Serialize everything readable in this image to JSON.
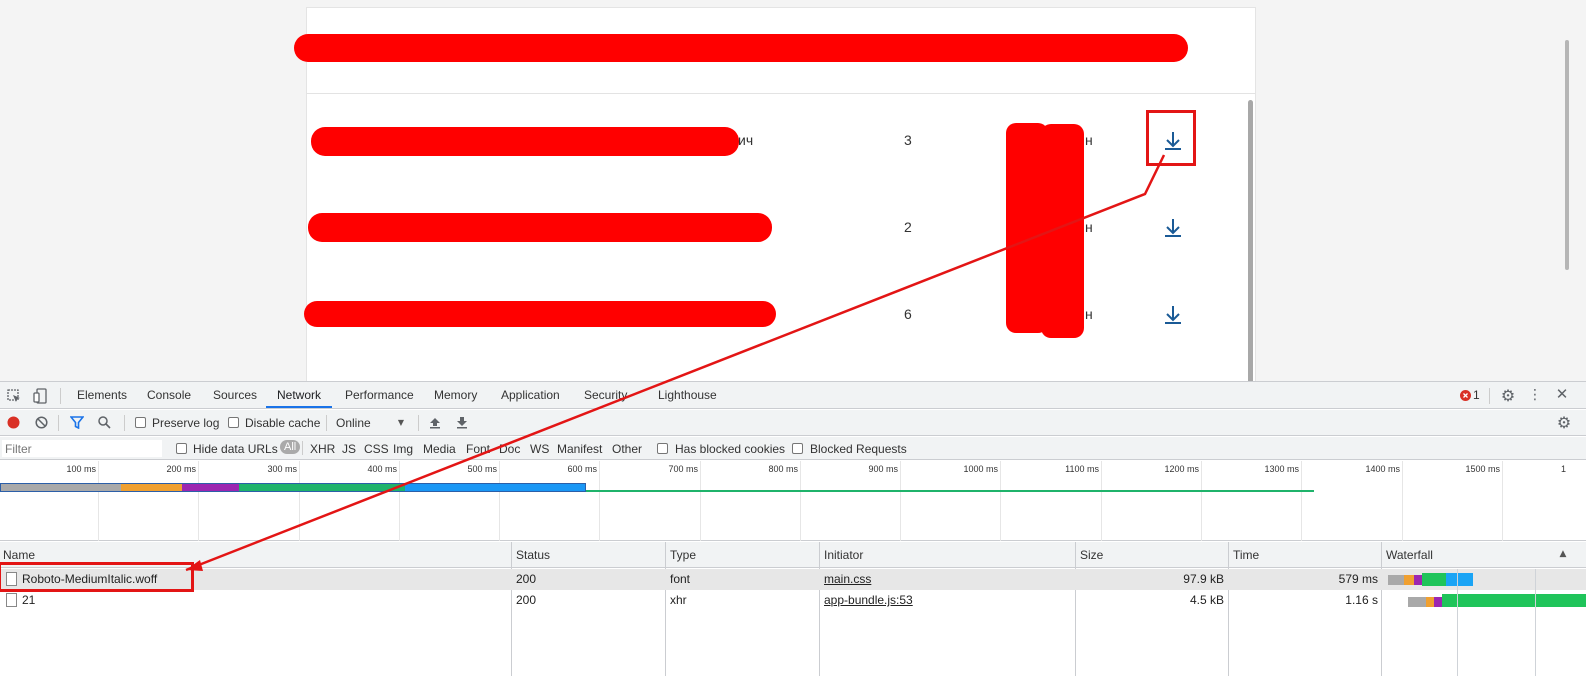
{
  "page": {
    "rows": [
      {
        "name_suffix": "ич",
        "count": "3",
        "unit_suffix": "н"
      },
      {
        "name_suffix": "",
        "count": "2",
        "unit_suffix": "н"
      },
      {
        "name_suffix": "",
        "count": "6",
        "unit_suffix": "н"
      }
    ],
    "download_icon": "download-icon"
  },
  "devtools": {
    "tabs": [
      "Elements",
      "Console",
      "Sources",
      "Network",
      "Performance",
      "Memory",
      "Application",
      "Security",
      "Lighthouse"
    ],
    "active_tab": "Network",
    "error_count": "1",
    "toolbar": {
      "preserve_log": "Preserve log",
      "disable_cache": "Disable cache",
      "throttle": "Online"
    },
    "filterbar": {
      "placeholder": "Filter",
      "hide_data_urls": "Hide data URLs",
      "types": [
        "All",
        "XHR",
        "JS",
        "CSS",
        "Img",
        "Media",
        "Font",
        "Doc",
        "WS",
        "Manifest",
        "Other"
      ],
      "has_blocked_cookies": "Has blocked cookies",
      "blocked_requests": "Blocked Requests"
    },
    "overview_ticks": [
      "100 ms",
      "200 ms",
      "300 ms",
      "400 ms",
      "500 ms",
      "600 ms",
      "700 ms",
      "800 ms",
      "900 ms",
      "1000 ms",
      "1100 ms",
      "1200 ms",
      "1300 ms",
      "1400 ms",
      "1500 ms",
      "1"
    ],
    "columns": {
      "name": "Name",
      "status": "Status",
      "type": "Type",
      "initiator": "Initiator",
      "size": "Size",
      "time": "Time",
      "waterfall": "Waterfall"
    },
    "requests": [
      {
        "name": "Roboto-MediumItalic.woff",
        "status": "200",
        "type": "font",
        "initiator": "main.css",
        "size": "97.9 kB",
        "time": "579 ms"
      },
      {
        "name": "21",
        "status": "200",
        "type": "xhr",
        "initiator": "app-bundle.js:53",
        "size": "4.5 kB",
        "time": "1.16 s"
      }
    ]
  },
  "colors": {
    "redaction": "#ff0000",
    "annotation": "#e31515",
    "accent": "#1a73e8",
    "download_icon": "#1a5a96"
  }
}
